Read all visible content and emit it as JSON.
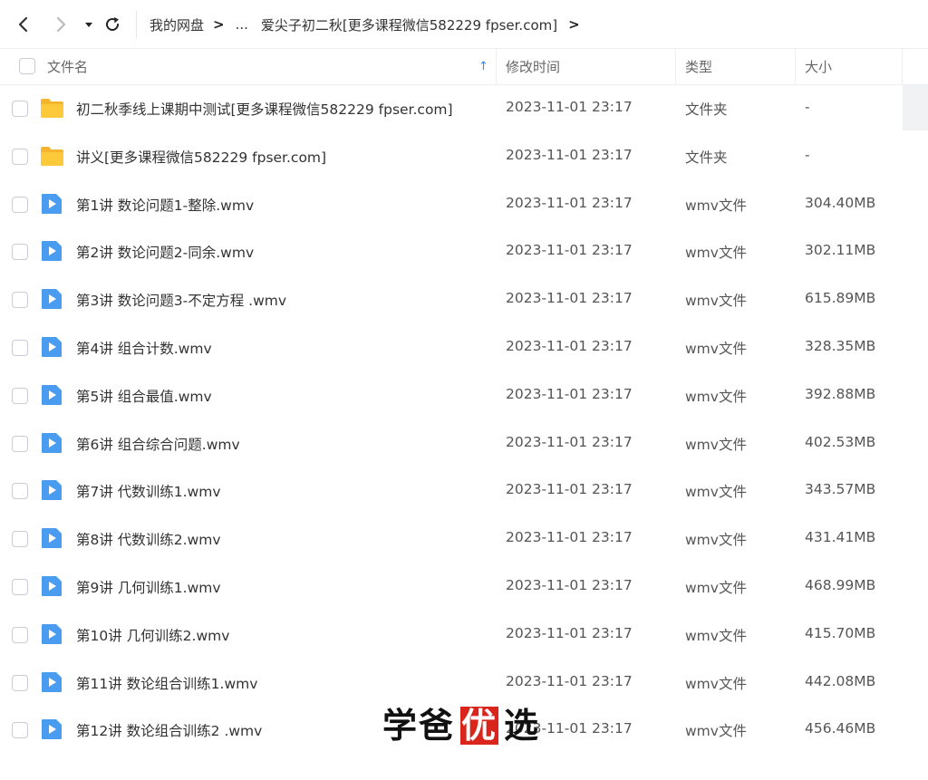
{
  "breadcrumb": {
    "root": "我的网盘",
    "ellipsis": "...",
    "current": "爱尖子初二秋[更多课程微信582229 fpser.com]"
  },
  "icons": {
    "back": "chevron-left-icon",
    "forward": "chevron-right-icon",
    "history": "caret-down-icon",
    "refresh": "refresh-icon",
    "folder": "folder-icon",
    "video": "video-file-icon"
  },
  "colors": {
    "accent": "#2b8cf5",
    "folder": "#fbbf24",
    "video": "#4a9cf0",
    "watermark_box": "#d9251c"
  },
  "table": {
    "headers": {
      "name": "文件名",
      "modified": "修改时间",
      "type": "类型",
      "size": "大小"
    },
    "sort_indicator": "↑",
    "rows": [
      {
        "kind": "folder",
        "name": "初二秋季线上课期中测试[更多课程微信582229 fpser.com]",
        "modified": "2023-11-01 23:17",
        "type": "文件夹",
        "size": "-"
      },
      {
        "kind": "folder",
        "name": "讲义[更多课程微信582229 fpser.com]",
        "modified": "2023-11-01 23:17",
        "type": "文件夹",
        "size": "-"
      },
      {
        "kind": "video",
        "name": "第1讲 数论问题1-整除.wmv",
        "modified": "2023-11-01 23:17",
        "type": "wmv文件",
        "size": "304.40MB"
      },
      {
        "kind": "video",
        "name": "第2讲 数论问题2-同余.wmv",
        "modified": "2023-11-01 23:17",
        "type": "wmv文件",
        "size": "302.11MB"
      },
      {
        "kind": "video",
        "name": "第3讲 数论问题3-不定方程 .wmv",
        "modified": "2023-11-01 23:17",
        "type": "wmv文件",
        "size": "615.89MB"
      },
      {
        "kind": "video",
        "name": "第4讲 组合计数.wmv",
        "modified": "2023-11-01 23:17",
        "type": "wmv文件",
        "size": "328.35MB"
      },
      {
        "kind": "video",
        "name": "第5讲 组合最值.wmv",
        "modified": "2023-11-01 23:17",
        "type": "wmv文件",
        "size": "392.88MB"
      },
      {
        "kind": "video",
        "name": "第6讲 组合综合问题.wmv",
        "modified": "2023-11-01 23:17",
        "type": "wmv文件",
        "size": "402.53MB"
      },
      {
        "kind": "video",
        "name": "第7讲 代数训练1.wmv",
        "modified": "2023-11-01 23:17",
        "type": "wmv文件",
        "size": "343.57MB"
      },
      {
        "kind": "video",
        "name": "第8讲 代数训练2.wmv",
        "modified": "2023-11-01 23:17",
        "type": "wmv文件",
        "size": "431.41MB"
      },
      {
        "kind": "video",
        "name": "第9讲 几何训练1.wmv",
        "modified": "2023-11-01 23:17",
        "type": "wmv文件",
        "size": "468.99MB"
      },
      {
        "kind": "video",
        "name": "第10讲 几何训练2.wmv",
        "modified": "2023-11-01 23:17",
        "type": "wmv文件",
        "size": "415.70MB"
      },
      {
        "kind": "video",
        "name": "第11讲 数论组合训练1.wmv",
        "modified": "2023-11-01 23:17",
        "type": "wmv文件",
        "size": "442.08MB"
      },
      {
        "kind": "video",
        "name": "第12讲 数论组合训练2 .wmv",
        "modified": "2023-11-01 23:17",
        "type": "wmv文件",
        "size": "456.46MB"
      }
    ]
  },
  "watermark": {
    "chars": [
      "学",
      "爸",
      "优",
      "选"
    ]
  }
}
